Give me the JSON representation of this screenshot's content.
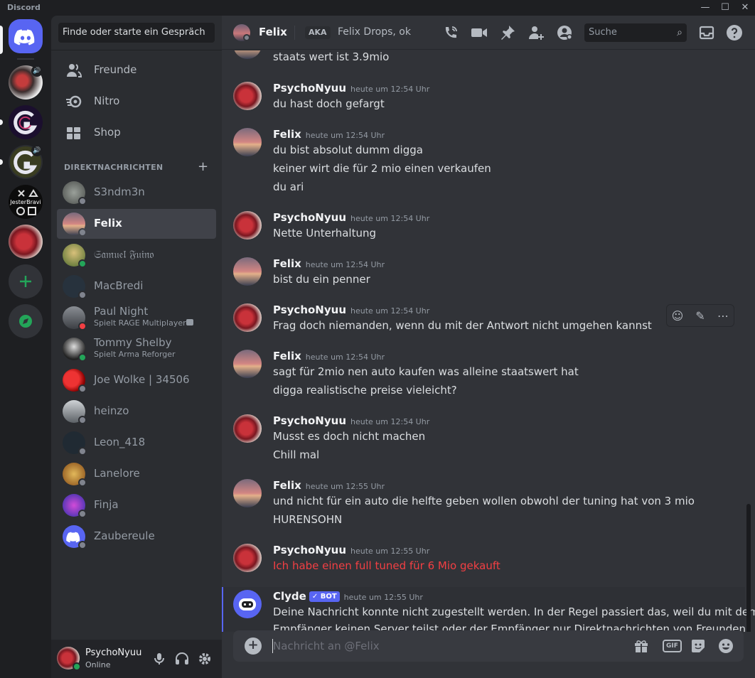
{
  "app": {
    "title": "Discord"
  },
  "window": {
    "min": "—",
    "max": "☐",
    "close": "✕"
  },
  "sidebar": {
    "search_placeholder": "Finde oder starte ein Gespräch",
    "nav": [
      {
        "label": "Freunde",
        "icon": "friends-icon"
      },
      {
        "label": "Nitro",
        "icon": "nitro-icon"
      },
      {
        "label": "Shop",
        "icon": "shop-icon"
      }
    ],
    "dm_header": "DIREKTNACHRICHTEN",
    "dm_add": "+",
    "dms": [
      {
        "name": "S3ndm3n",
        "status": "offline"
      },
      {
        "name": "Felix",
        "status": "offline",
        "selected": true
      },
      {
        "name": "𝔖𝔞𝔪𝔲𝔢𝔩 𝔉𝔲𝔦𝔫𝔬",
        "status": "online"
      },
      {
        "name": "MacBredi",
        "status": "offline"
      },
      {
        "name": "Paul Night",
        "status": "dnd",
        "activity": "Spielt RAGE Multiplayer"
      },
      {
        "name": "Tommy Shelby",
        "status": "online",
        "activity": "Spielt Arma Reforger"
      },
      {
        "name": "Joe Wolke | 34506",
        "status": "offline"
      },
      {
        "name": "heinzo",
        "status": "offline"
      },
      {
        "name": "Leon_418",
        "status": "offline"
      },
      {
        "name": "Lanelore",
        "status": "offline"
      },
      {
        "name": "Finja",
        "status": "offline"
      },
      {
        "name": "Zaubereule",
        "status": "offline"
      }
    ]
  },
  "user": {
    "name": "PsychoNyuu",
    "status": "Online"
  },
  "channel": {
    "name": "Felix",
    "aka_label": "AKA",
    "aka_names": "Felix Drops, ok",
    "search_placeholder": "Suche"
  },
  "messages": [
    {
      "author": "",
      "time": "",
      "lines": [
        "staats wert ist 3.9mio"
      ]
    },
    {
      "author": "PsychoNyuu",
      "time": "heute um 12:54 Uhr",
      "lines": [
        "du hast doch gefargt"
      ]
    },
    {
      "author": "Felix",
      "time": "heute um 12:54 Uhr",
      "lines": [
        "du bist absolut dumm digga",
        "keiner wirt die für 2 mio einen verkaufen",
        "du ari"
      ]
    },
    {
      "author": "PsychoNyuu",
      "time": "heute um 12:54 Uhr",
      "lines": [
        "Nette Unterhaltung"
      ]
    },
    {
      "author": "Felix",
      "time": "heute um 12:54 Uhr",
      "lines": [
        "bist du ein penner"
      ]
    },
    {
      "author": "PsychoNyuu",
      "time": "heute um 12:54 Uhr",
      "lines": [
        "Frag doch niemanden, wenn du mit der Antwort nicht umgehen kannst"
      ]
    },
    {
      "author": "Felix",
      "time": "heute um 12:54 Uhr",
      "lines": [
        "sagt für 2mio nen auto kaufen was alleine staatswert hat",
        "digga realistische preise vieleicht?"
      ]
    },
    {
      "author": "PsychoNyuu",
      "time": "heute um 12:54 Uhr",
      "lines": [
        "Musst es doch nicht machen",
        "Chill mal"
      ]
    },
    {
      "author": "Felix",
      "time": "heute um 12:55 Uhr",
      "lines": [
        "und nicht für ein auto die helfte geben wollen obwohl der tuning hat von 3 mio",
        "HURENSOHN"
      ]
    },
    {
      "author": "PsychoNyuu",
      "time": "heute um 12:55 Uhr",
      "lines": [
        "Ich habe einen full tuned für 6 Mio gekauft"
      ],
      "failed": true,
      "color": "#f23f43"
    },
    {
      "author": "Clyde",
      "badge": "✓ BOT",
      "time": "heute um 12:55 Uhr",
      "lines": [
        "Deine Nachricht konnte nicht zugestellt werden. In der Regel passiert das, weil du mit dem",
        "Empfänger keinen Server teilst oder der Empfänger nur Direktnachrichten von Freunden"
      ]
    }
  ],
  "composer": {
    "placeholder": "Nachricht an @Felix",
    "gif_label": "GIF"
  },
  "colors": {
    "accent": "#5865f2",
    "online": "#23a559",
    "dnd": "#f23f43",
    "error": "#f23f43"
  }
}
